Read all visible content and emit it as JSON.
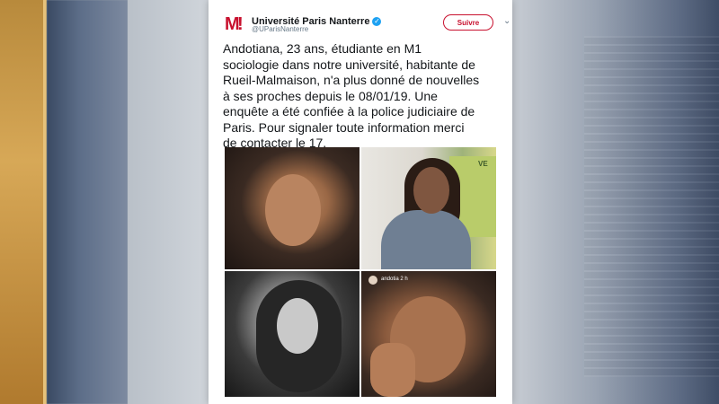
{
  "account": {
    "name": "Université Paris Nanterre",
    "handle": "@UParisNanterre",
    "follow_label": "Suivre",
    "logo_icon": "nanterre-logo-icon",
    "brand_color": "#c8102e"
  },
  "tweet": {
    "lines": [
      "Andotiana, 23 ans, étudiante en M1",
      "sociologie dans notre université, habitante de",
      "Rueil-Malmaison, n'a plus donné de nouvelles",
      "à ses proches depuis le 08/01/19. Une",
      "enquête a été confiée à la police judiciaire de",
      "Paris. Pour signaler toute information merci",
      "de contacter le 17."
    ]
  },
  "photos": {
    "instagram_caption": "andotia 2 h",
    "sign_text": "VE"
  },
  "icons": {
    "verified": "verified-badge-icon",
    "menu": "chevron-down-icon"
  }
}
